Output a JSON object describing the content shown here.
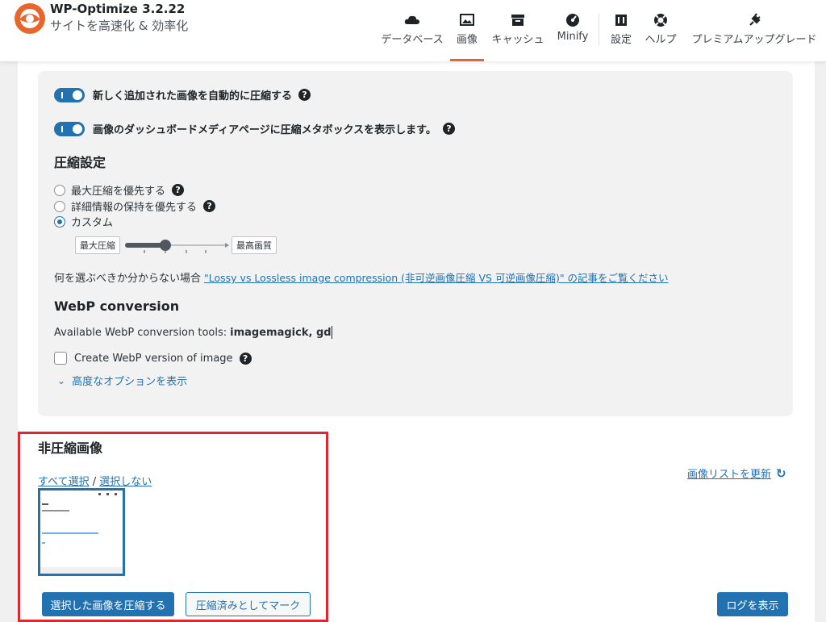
{
  "header": {
    "title": "WP-Optimize 3.2.22",
    "subtitle": "サイトを高速化 & 効率化",
    "nav": [
      {
        "label": "データベース",
        "icon": "cloud-icon"
      },
      {
        "label": "画像",
        "icon": "image-icon",
        "active": true
      },
      {
        "label": "キャッシュ",
        "icon": "archive-icon"
      },
      {
        "label": "Minify",
        "icon": "dashboard-icon"
      },
      {
        "label": "設定",
        "icon": "settings-icon"
      },
      {
        "label": "ヘルプ",
        "icon": "lifebuoy-icon"
      },
      {
        "label": "プレミアムアップグレード",
        "icon": "plugin-icon"
      }
    ],
    "accent_color": "#e8662c"
  },
  "panel": {
    "toggle1_label": "新しく追加された画像を自動的に圧縮する",
    "toggle2_label": "画像のダッシュボードメディアページに圧縮メタボックスを表示します。",
    "compression_heading": "圧縮設定",
    "radio1": "最大圧縮を優先する",
    "radio2": "詳細情報の保持を優先する",
    "radio3": "カスタム",
    "slider_left": "最大圧縮",
    "slider_right": "最高画質",
    "help_text": "何を選ぶべきか分からない場合",
    "help_link": "\"Lossy vs Lossless image compression (非可逆画像圧縮 VS 可逆画像圧縮)\" の記事をご覧ください",
    "webp_heading": "WebP conversion",
    "webp_tools_label": "Available WebP conversion tools:",
    "webp_tools_value": "imagemagick, gd",
    "webp_checkbox": "Create WebP version of image",
    "advanced_link": "高度なオプションを表示",
    "help_glyph": "?"
  },
  "uncompressed": {
    "title": "非圧縮画像",
    "select_all": "すべて選択",
    "separator": "/",
    "select_none": "選択しない",
    "refresh": "画像リストを更新",
    "compress_button": "選択した画像を圧縮する",
    "mark_button": "圧縮済みとしてマーク",
    "log_button": "ログを表示"
  },
  "colors": {
    "primary": "#2271b1",
    "highlight": "#e1262d"
  }
}
